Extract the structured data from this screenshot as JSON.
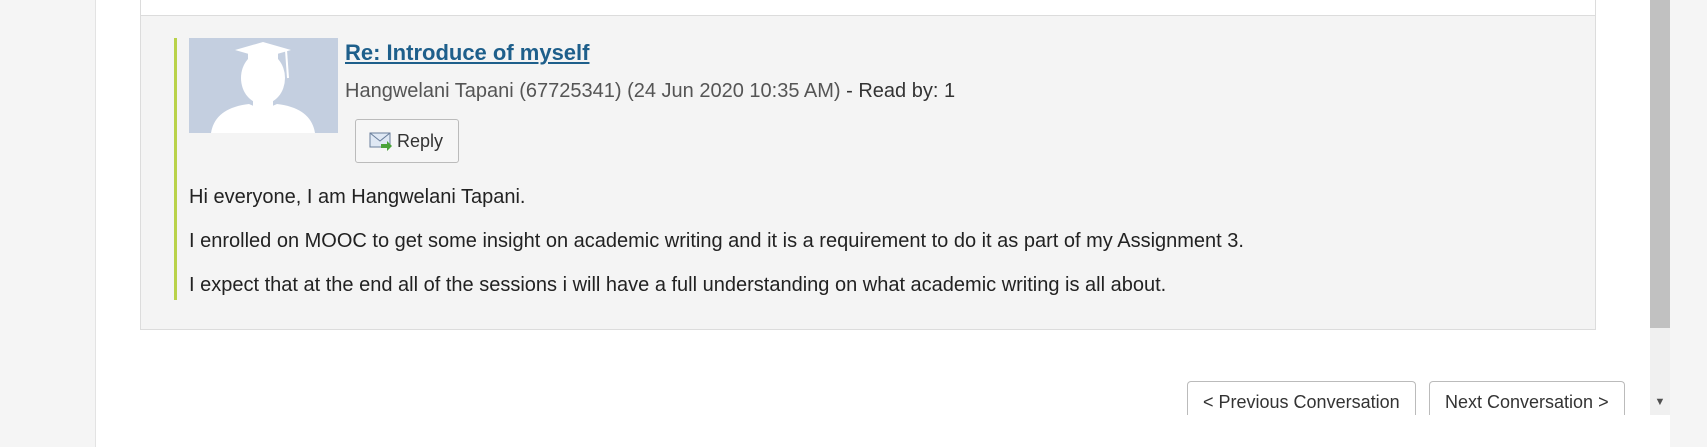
{
  "post": {
    "title": "Re: Introduce of myself",
    "author": "Hangwelani Tapani (67725341)",
    "date": "(24 Jun 2020 10:35 AM)",
    "read_by": "- Read by: 1",
    "reply_label": "Reply",
    "paragraphs": [
      "Hi everyone, I am Hangwelani Tapani.",
      "I enrolled on MOOC to get some insight on academic writing and it is a requirement to do it as part of my Assignment 3.",
      "I expect that at the end all of the sessions i will have a full understanding on what academic writing is all about."
    ]
  },
  "navigation": {
    "previous_label": "< Previous Conversation",
    "next_label": "Next Conversation >"
  },
  "colors": {
    "link": "#1e5f8b",
    "accent_border": "#b9d24a",
    "avatar_bg": "#c4cfe0"
  },
  "icons": {
    "avatar": "graduate-silhouette-icon",
    "reply": "envelope-reply-icon",
    "scroll_down": "triangle-down-icon"
  }
}
